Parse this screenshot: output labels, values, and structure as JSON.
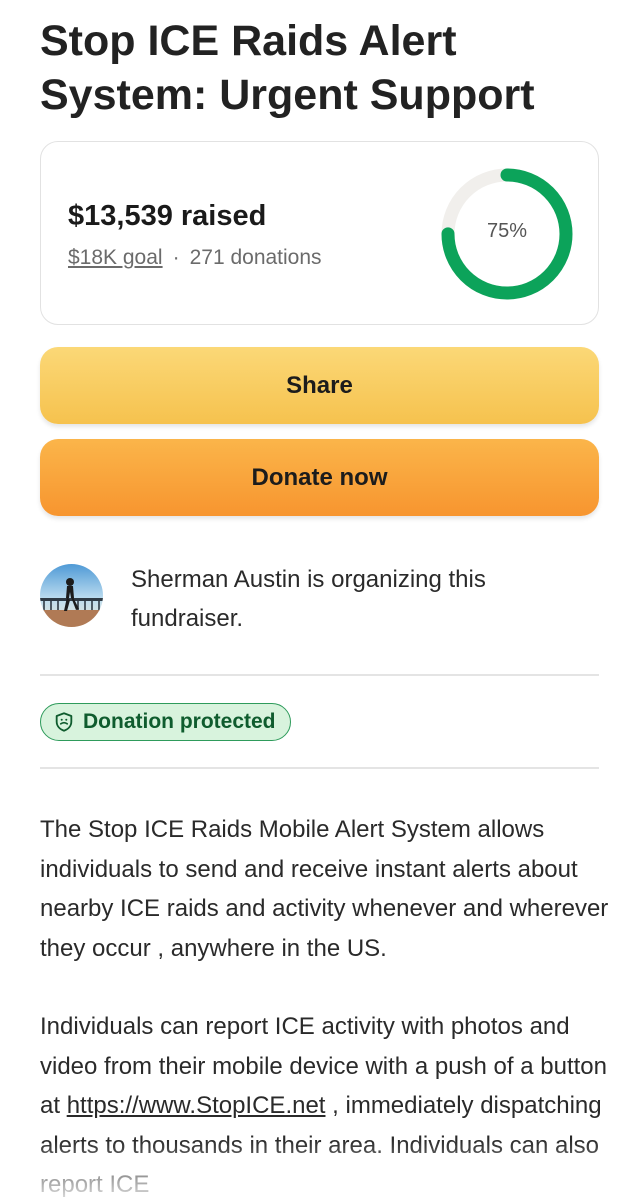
{
  "fundraiser": {
    "title": "Stop ICE Raids Alert System: Urgent Support"
  },
  "stats": {
    "raised_text": "$13,539 raised",
    "goal_text": "$18K goal",
    "separator": "·",
    "donations_text": "271 donations",
    "progress_label": "75%",
    "progress_fraction": 0.75,
    "ring_color": "#0ca35a",
    "ring_track_color": "#f1efec"
  },
  "actions": {
    "share_label": "Share",
    "donate_label": "Donate now"
  },
  "organizer": {
    "text": "Sherman Austin is organizing this fundraiser."
  },
  "badge": {
    "icon": "shield-icon",
    "label": "Donation protected"
  },
  "story": {
    "paragraph1": "The Stop ICE Raids Mobile Alert System allows individuals to send and receive instant alerts about nearby ICE raids and activity whenever and wherever they occur , anywhere in the US.",
    "paragraph2_before_link": "Individuals can report ICE activity with photos and video from their mobile device with a push of a button at ",
    "link_text": "https://www.StopICE.net",
    "paragraph2_after_link": " , immediately dispatching alerts to thousands in their area. Individuals can also report ICE"
  }
}
